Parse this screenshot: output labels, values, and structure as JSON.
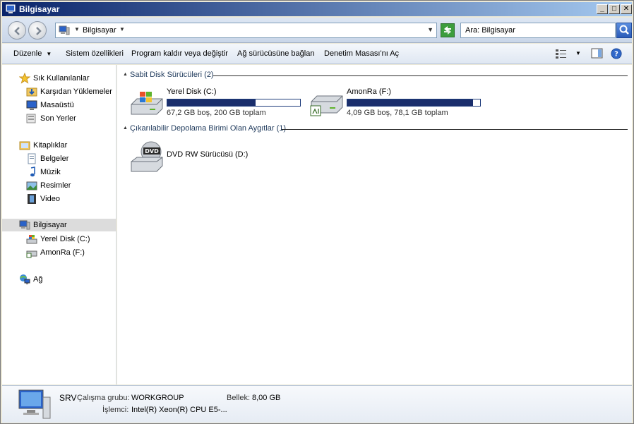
{
  "window": {
    "title": "Bilgisayar"
  },
  "address": {
    "crumb": "Bilgisayar"
  },
  "search": {
    "placeholder": "Ara: Bilgisayar"
  },
  "commands": {
    "organize": "Düzenle",
    "system_properties": "Sistem özellikleri",
    "uninstall": "Program kaldır veya değiştir",
    "map_drive": "Ağ sürücüsüne bağlan",
    "control_panel": "Denetim Masası'nı Aç"
  },
  "sidebar": {
    "favorites": "Sık Kullanılanlar",
    "downloads": "Karşıdan Yüklemeler",
    "desktop": "Masaüstü",
    "recent": "Son Yerler",
    "libraries": "Kitaplıklar",
    "documents": "Belgeler",
    "music": "Müzik",
    "pictures": "Resimler",
    "video": "Video",
    "computer": "Bilgisayar",
    "drive_c": "Yerel Disk (C:)",
    "drive_f": "AmonRa (F:)",
    "network": "Ağ"
  },
  "groups": {
    "hard_disks": "Sabit Disk Sürücüleri (2)",
    "removable": "Çıkarılabilir Depolama Birimi Olan Aygıtlar (1)"
  },
  "drives": [
    {
      "name": "Yerel Disk (C:)",
      "info": "67,2 GB boş, 200 GB toplam",
      "used_fraction": 0.664
    },
    {
      "name": "AmonRa (F:)",
      "info": "4,09 GB boş, 78,1 GB toplam",
      "used_fraction": 0.948
    }
  ],
  "removable_drives": [
    {
      "name": "DVD RW Sürücüsü (D:)",
      "badge": "DVD"
    }
  ],
  "details": {
    "name": "SRV",
    "workgroup_label": "Çalışma grubu:",
    "workgroup": "WORKGROUP",
    "memory_label": "Bellek:",
    "memory": "8,00 GB",
    "cpu_label": "İşlemci:",
    "cpu": "Intel(R) Xeon(R) CPU E5-..."
  }
}
